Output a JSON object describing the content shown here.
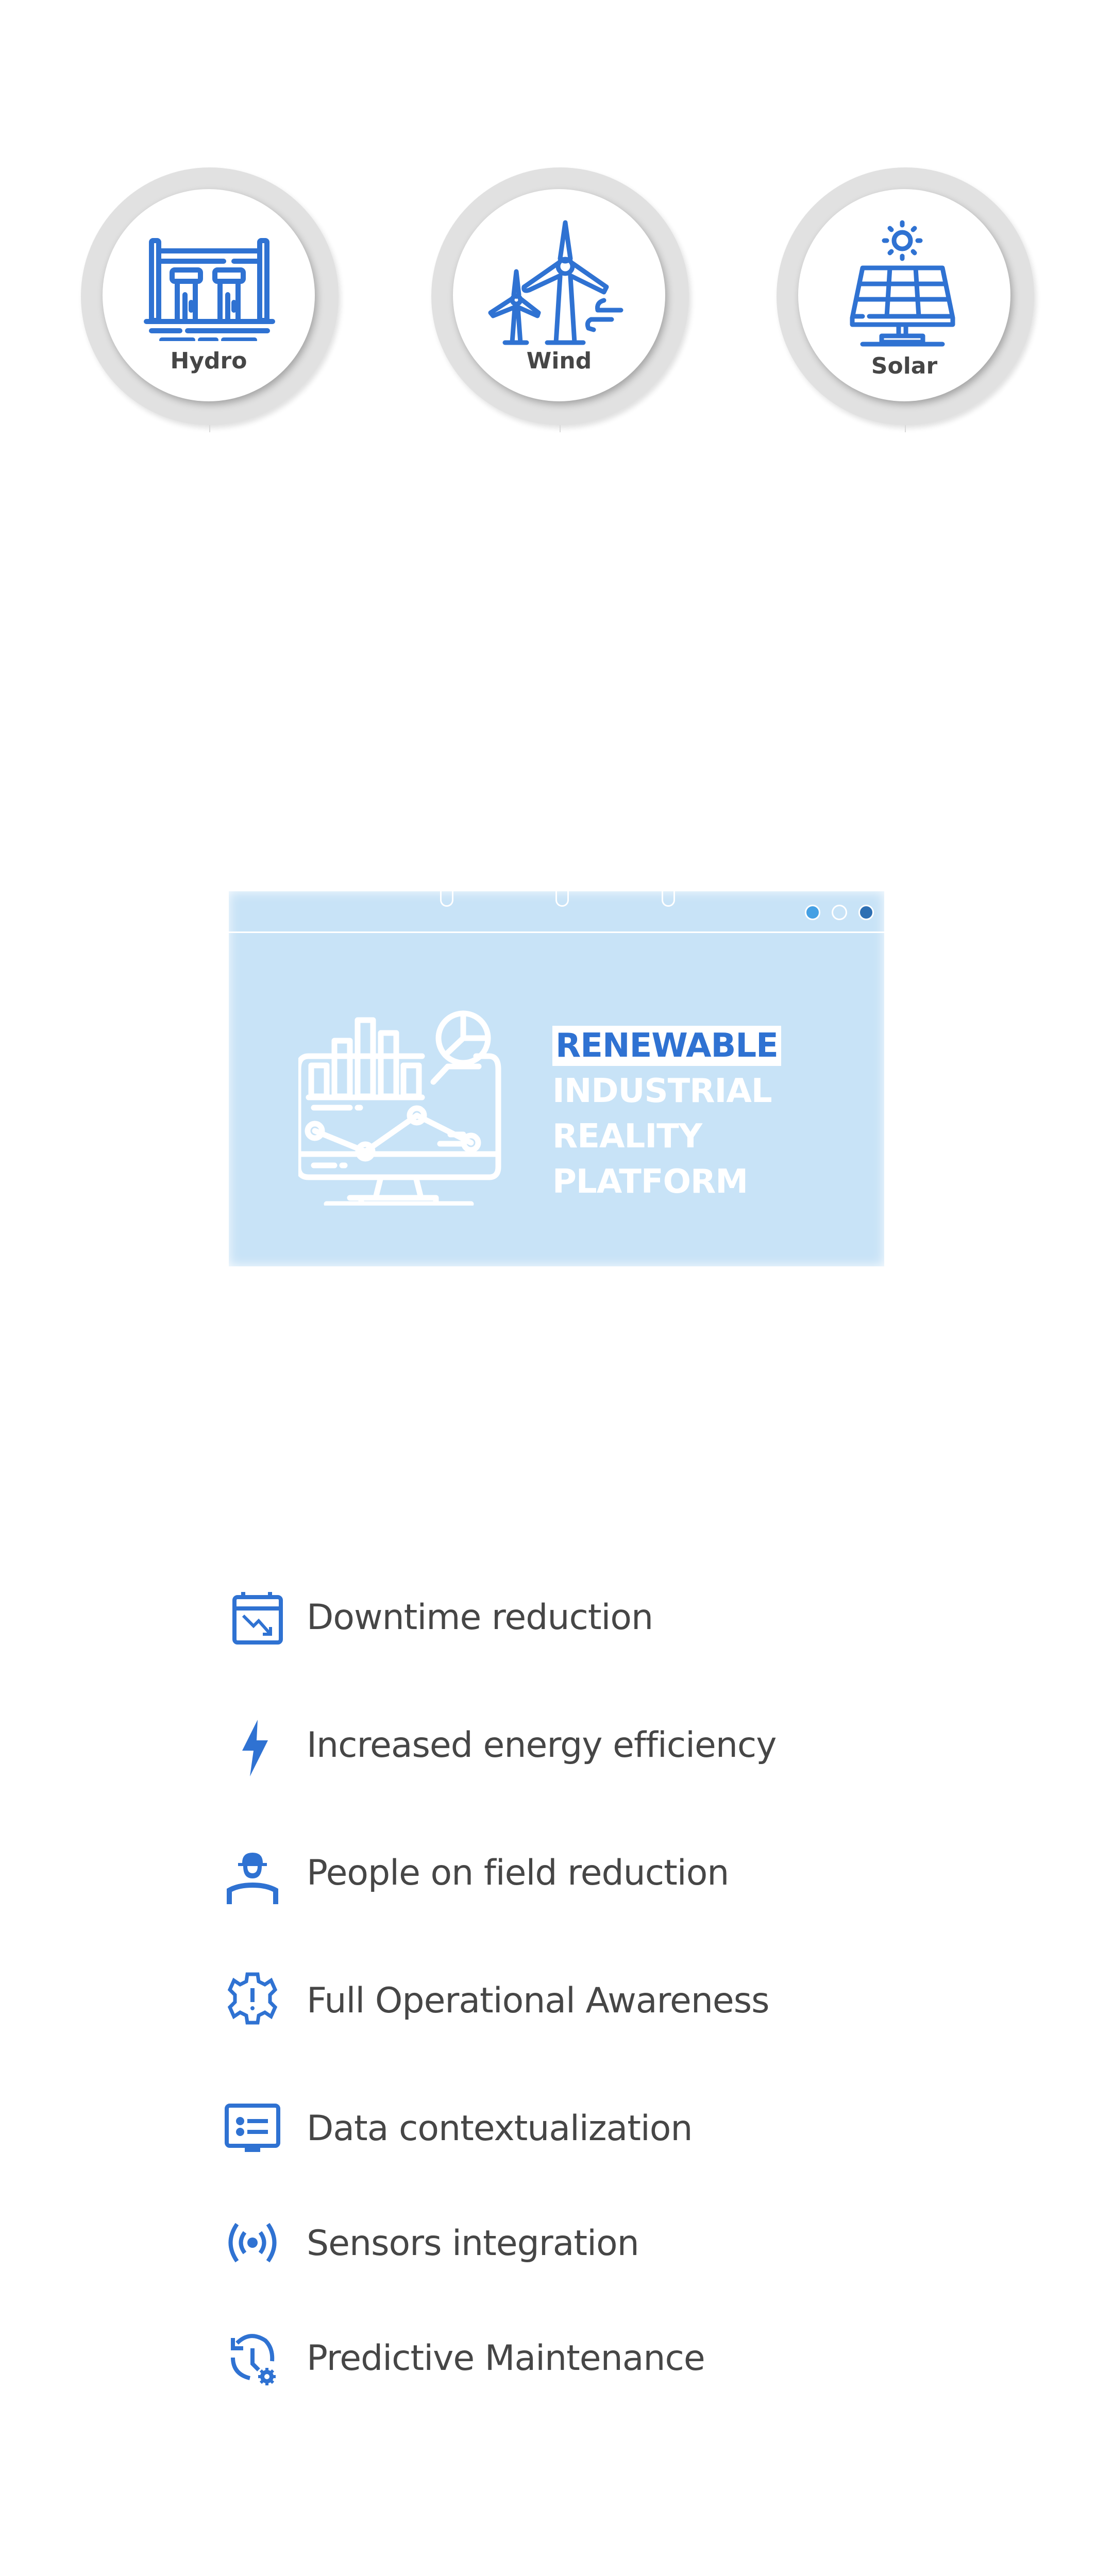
{
  "energy_sources": [
    {
      "label": "Hydro",
      "icon": "hydro-dam-icon"
    },
    {
      "label": "Wind",
      "icon": "wind-turbine-icon"
    },
    {
      "label": "Solar",
      "icon": "solar-panel-icon"
    }
  ],
  "banner": {
    "title_lines": [
      "RENEWABLE",
      "INDUSTRIAL",
      "REALITY",
      "PLATFORM"
    ],
    "illustration": "monitor-analytics-icon",
    "carousel_dots": [
      {
        "state": "inactive-light",
        "color": "#44a0e4"
      },
      {
        "state": "inactive-empty",
        "color": "#c8e3f7"
      },
      {
        "state": "active",
        "color": "#2d6fb3"
      }
    ]
  },
  "features": [
    {
      "label": "Downtime reduction",
      "icon": "calendar-trend-down-icon"
    },
    {
      "label": "Increased energy efficiency",
      "icon": "lightning-bolt-icon"
    },
    {
      "label": "People on field reduction",
      "icon": "worker-helmet-icon"
    },
    {
      "label": "Full Operational Awareness",
      "icon": "gear-alert-icon"
    },
    {
      "label": "Data contextualization",
      "icon": "monitor-list-icon"
    },
    {
      "label": "Sensors integration",
      "icon": "sensor-signal-icon"
    },
    {
      "label": "Predictive Maintenance",
      "icon": "history-gear-icon"
    }
  ],
  "colors": {
    "accent": "#2f72d2",
    "text": "#464646",
    "banner_bg": "#c8e3f7",
    "ring": "#e1e1e1"
  }
}
